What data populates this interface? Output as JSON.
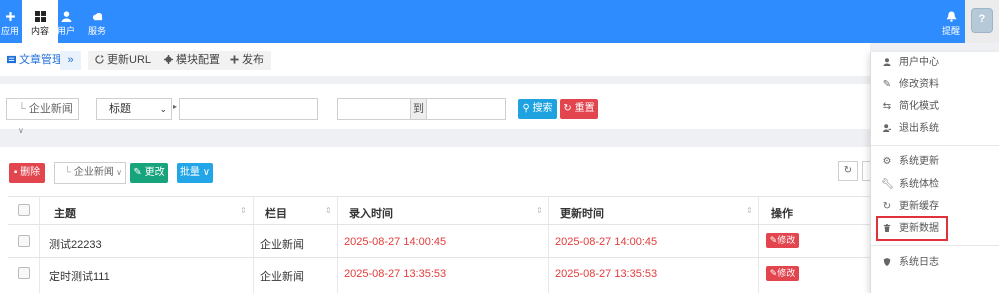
{
  "topnav": {
    "items": [
      {
        "label": "应用",
        "icon": "apps-icon"
      },
      {
        "label": "内容",
        "icon": "grid-icon"
      },
      {
        "label": "用户",
        "icon": "user-icon"
      },
      {
        "label": "服务",
        "icon": "cloud-icon"
      }
    ],
    "active": "内容",
    "bell_label": "提醒",
    "avatar_text": "?"
  },
  "tabs": {
    "article_manage": "文章管理",
    "expand": "»",
    "update_url": "更新URL",
    "module_config": "模块配置",
    "publish": "发布"
  },
  "search": {
    "category": "企业新闻",
    "field": "标题",
    "keyword": "",
    "date_to": "到",
    "search_btn": "搜索",
    "reset_btn": "重置"
  },
  "toolbar": {
    "delete_btn": "删除",
    "category": "企业新闻",
    "change_btn": "更改",
    "batch_btn": "批量"
  },
  "table": {
    "headers": [
      "主题",
      "栏目",
      "录入时间",
      "更新时间",
      "操作"
    ],
    "rows": [
      {
        "title": "测试22233",
        "column": "企业新闻",
        "created": "2025-08-27 14:00:45",
        "updated": "2025-08-27 14:00:45",
        "action": "修改"
      },
      {
        "title": "定时测试111",
        "column": "企业新闻",
        "created": "2025-08-27 13:35:53",
        "updated": "2025-08-27 13:35:53",
        "action": "修改"
      }
    ]
  },
  "dropdown": {
    "items": [
      {
        "label": "用户中心",
        "icon": "user-icon"
      },
      {
        "label": "修改资料",
        "icon": "edit-icon"
      },
      {
        "label": "简化模式",
        "icon": "retweet-icon"
      },
      {
        "label": "退出系统",
        "icon": "user-logout-icon"
      },
      {
        "label": "系统更新",
        "icon": "gears-icon"
      },
      {
        "label": "系统体检",
        "icon": "wrench-icon"
      },
      {
        "label": "更新缓存",
        "icon": "refresh-icon"
      },
      {
        "label": "更新数据",
        "icon": "trash-icon"
      },
      {
        "label": "系统日志",
        "icon": "shield-icon"
      }
    ],
    "highlighted": "更新数据"
  },
  "colors": {
    "navbar": "#2f8cff",
    "date_text": "#e33b3b",
    "search_btn": "#1ea2e0",
    "reset_btn": "#e3454f",
    "change_btn": "#17a47c",
    "highlight_border": "#e0323a"
  }
}
